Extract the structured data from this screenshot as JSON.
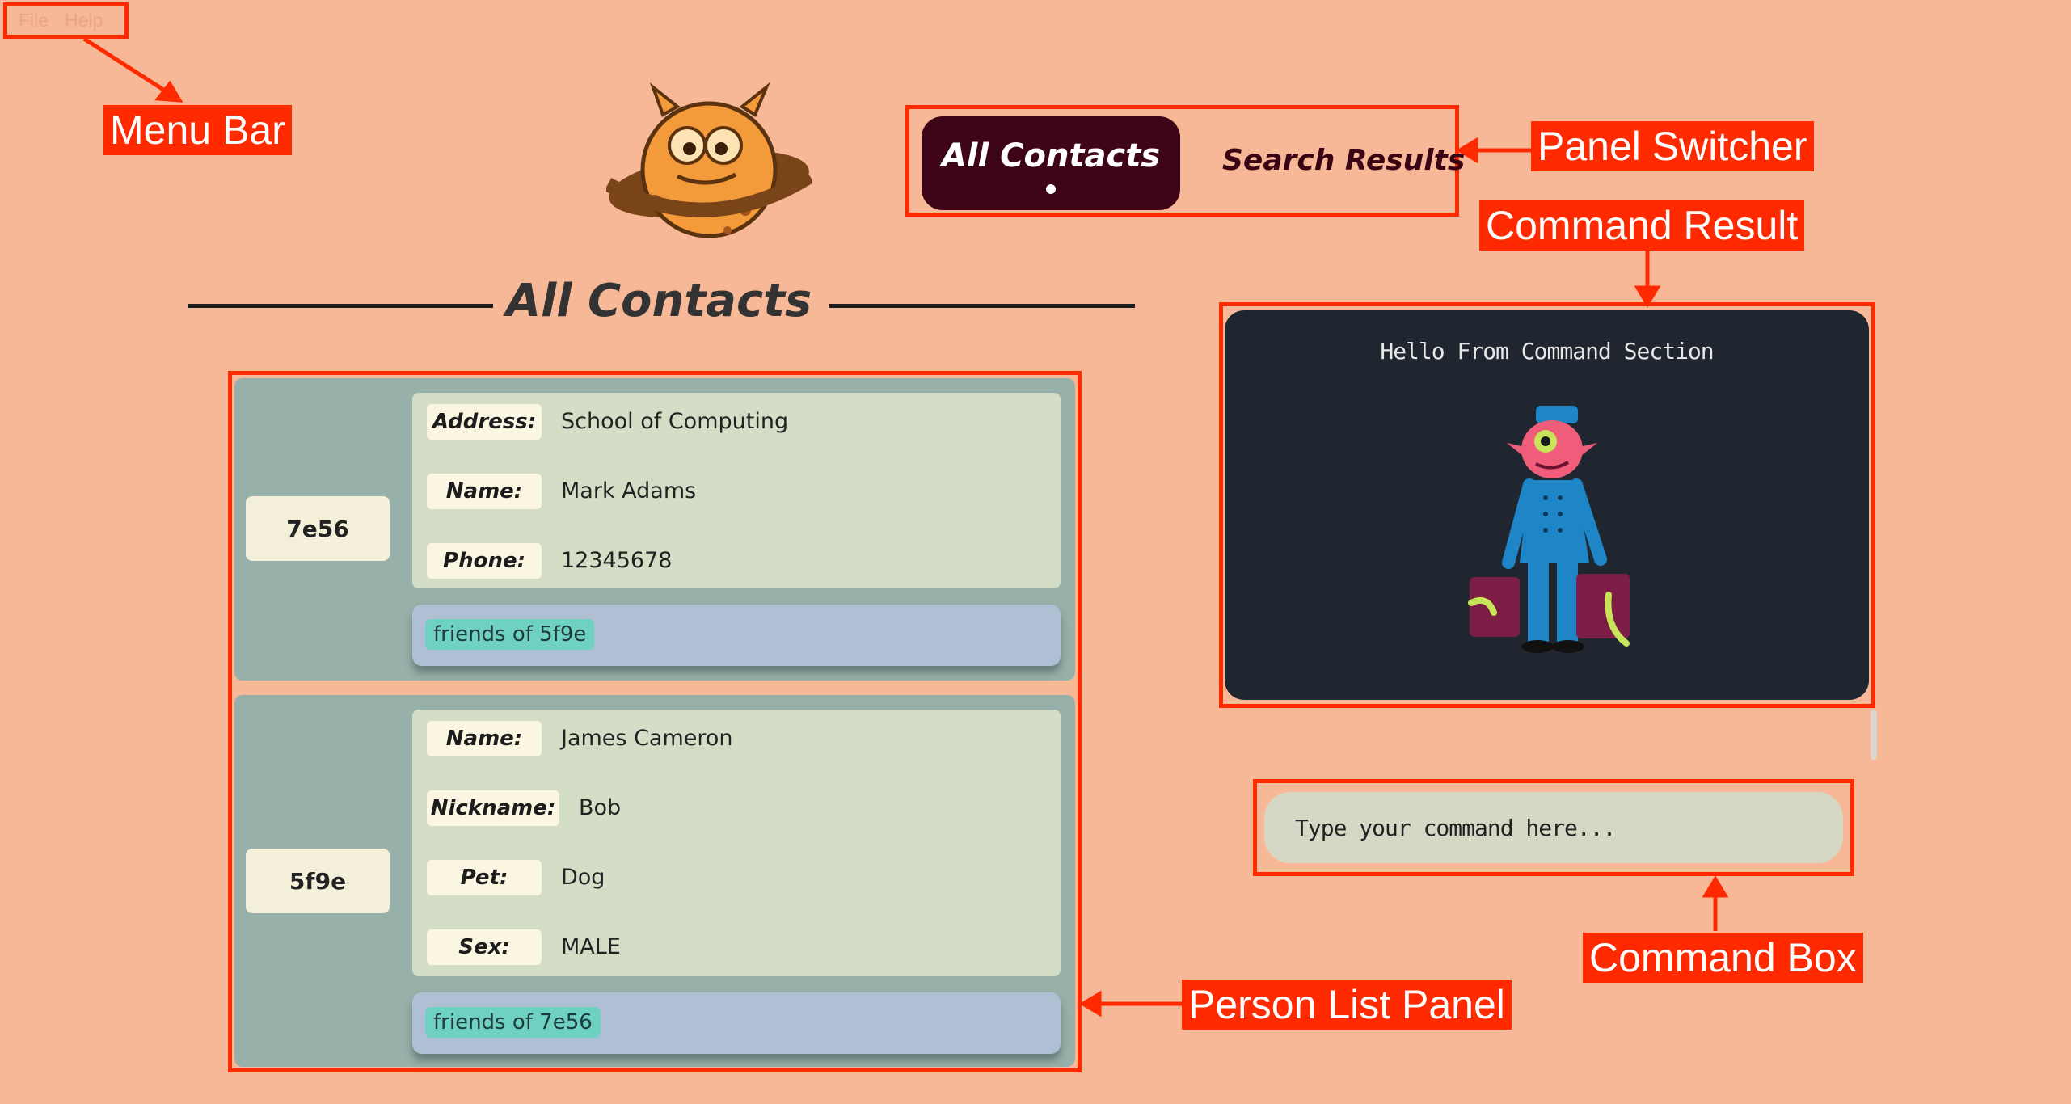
{
  "menu": {
    "file": "File",
    "help": "Help"
  },
  "annotations": {
    "menu_bar": "Menu Bar",
    "panel_switcher": "Panel Switcher",
    "command_result": "Command Result",
    "command_box": "Command Box",
    "person_list_panel": "Person List Panel"
  },
  "tabs": {
    "active": "All Contacts",
    "inactive": "Search Results"
  },
  "heading": "All Contacts",
  "persons": [
    {
      "id": "7e56",
      "fields": [
        {
          "key": "Address:",
          "value": "School of Computing"
        },
        {
          "key": "Name:",
          "value": "Mark Adams"
        },
        {
          "key": "Phone:",
          "value": "12345678"
        }
      ],
      "tag": "friends of 5f9e"
    },
    {
      "id": "5f9e",
      "fields": [
        {
          "key": "Name:",
          "value": "James Cameron"
        },
        {
          "key": "Nickname:",
          "value": "Bob"
        },
        {
          "key": "Pet:",
          "value": "Dog"
        },
        {
          "key": "Sex:",
          "value": "MALE"
        }
      ],
      "tag": "friends of 7e56"
    }
  ],
  "command_result": {
    "message": "Hello From Command Section"
  },
  "command_box": {
    "placeholder": "Type your command here..."
  },
  "colors": {
    "background": "#f6b896",
    "annotation_red": "#ff2a00",
    "active_tab": "#3e0518",
    "result_bg": "#20262f",
    "card_bg": "#97b1aa",
    "tag_bg": "#6fd1c2"
  },
  "icons": {
    "logo": "planet-monster-logo-icon",
    "mascot": "bellhop-monster-illustration-icon"
  }
}
